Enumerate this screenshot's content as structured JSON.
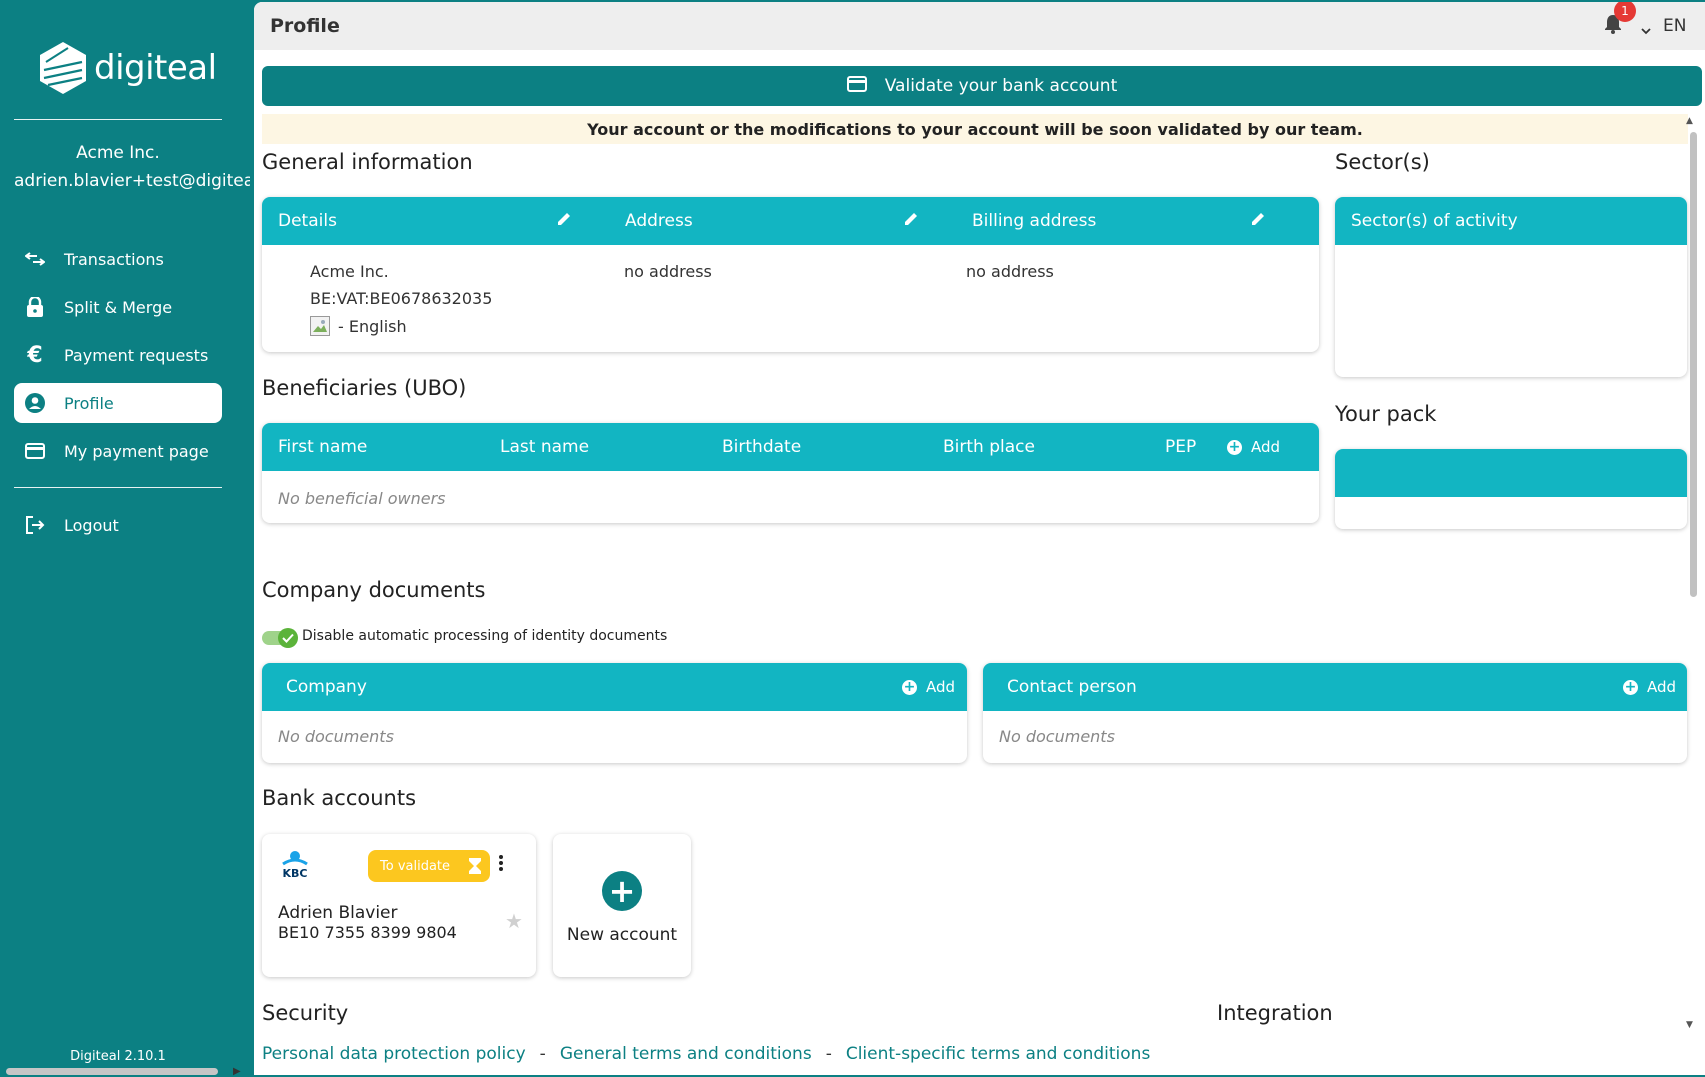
{
  "sidebar": {
    "logo_text": "digiteal",
    "company_name": "Acme Inc.",
    "company_email": "adrien.blavier+test@digiteal.eu",
    "items": [
      {
        "label": "Transactions",
        "icon": "arrows-exchange-icon"
      },
      {
        "label": "Split & Merge",
        "icon": "lock-icon"
      },
      {
        "label": "Payment requests",
        "icon": "euro-icon"
      },
      {
        "label": "Profile",
        "icon": "account-circle-icon",
        "active": true
      },
      {
        "label": "My payment page",
        "icon": "credit-card-icon"
      }
    ],
    "logout_label": "Logout",
    "version": "Digiteal 2.10.1"
  },
  "topbar": {
    "title": "Profile",
    "notification_count": "1",
    "language": "EN"
  },
  "validate_button": "Validate your bank account",
  "notice": "Your account or the modifications to your account will be soon validated by our team.",
  "general": {
    "title": "General information",
    "headers": {
      "details": "Details",
      "address": "Address",
      "billing": "Billing address"
    },
    "details": {
      "name": "Acme Inc.",
      "vat": "BE:VAT:BE0678632035",
      "language": "- English"
    },
    "address": "no address",
    "billing_address": "no address"
  },
  "sectors": {
    "title": "Sector(s)",
    "header": "Sector(s) of activity"
  },
  "pack": {
    "title": "Your pack"
  },
  "ubo": {
    "title": "Beneficiaries (UBO)",
    "columns": [
      "First name",
      "Last name",
      "Birthdate",
      "Birth place",
      "PEP"
    ],
    "add_label": "Add",
    "empty": "No beneficial owners"
  },
  "documents": {
    "title": "Company documents",
    "toggle_label": "Disable automatic processing of identity documents",
    "toggle_on": true,
    "company": {
      "header": "Company",
      "add_label": "Add",
      "empty": "No documents"
    },
    "contact": {
      "header": "Contact person",
      "add_label": "Add",
      "empty": "No documents"
    }
  },
  "bank": {
    "title": "Bank accounts",
    "account": {
      "bank_logo_text": "KBC",
      "status": "To validate",
      "holder": "Adrien Blavier",
      "iban": "BE10 7355 8399 9804"
    },
    "new_account_label": "New account"
  },
  "security": {
    "title": "Security"
  },
  "integration": {
    "title": "Integration"
  },
  "footer_links": [
    "Personal data protection policy",
    "General terms and conditions",
    "Client-specific terms and conditions"
  ],
  "colors": {
    "primary": "#0c8083",
    "header": "#12b5c2",
    "warning": "#fcc71f",
    "notice_bg": "#fdf6e3",
    "badge": "#e53935"
  }
}
